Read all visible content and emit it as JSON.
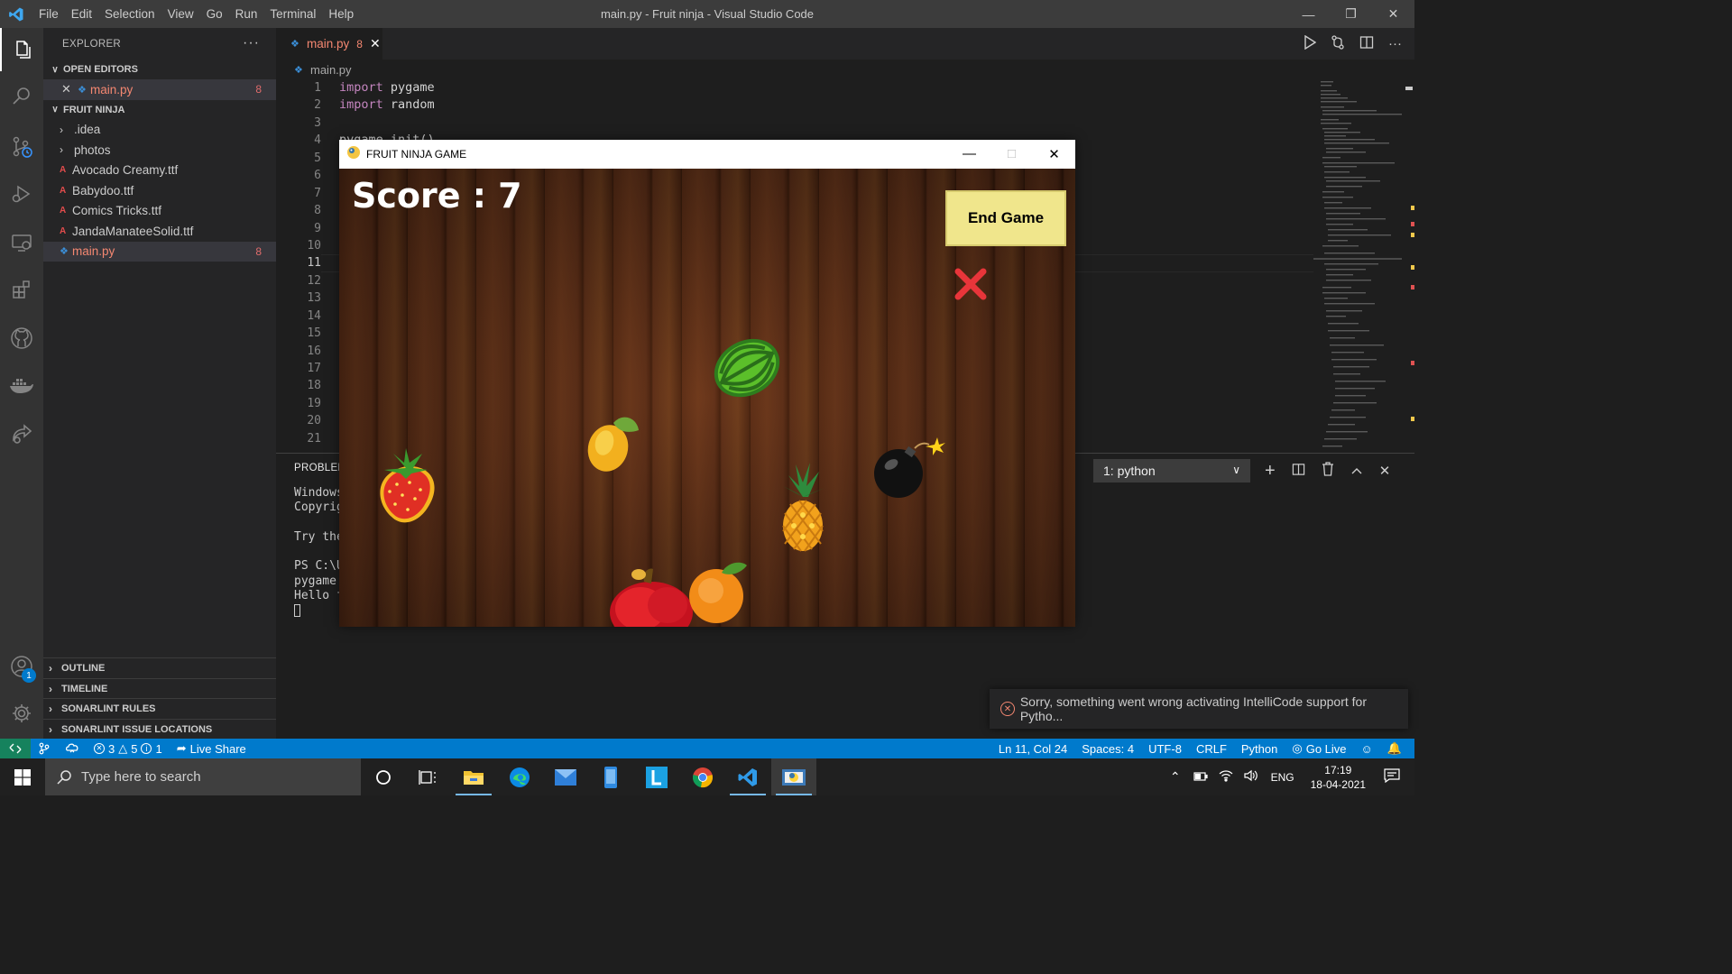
{
  "window": {
    "title": "main.py - Fruit ninja - Visual Studio Code",
    "menu": [
      "File",
      "Edit",
      "Selection",
      "View",
      "Go",
      "Run",
      "Terminal",
      "Help"
    ]
  },
  "activity_bar": {
    "items": [
      "explorer-icon",
      "search-icon",
      "source-control-icon",
      "run-debug-icon",
      "remote-explorer-icon",
      "extensions-icon",
      "github-icon",
      "docker-icon",
      "live-share-icon"
    ],
    "accounts_badge": "1"
  },
  "sidebar": {
    "title": "EXPLORER",
    "open_editors": {
      "header": "OPEN EDITORS",
      "items": [
        {
          "name": "main.py",
          "count": "8"
        }
      ]
    },
    "project": {
      "header": "FRUIT NINJA",
      "items": [
        {
          "name": ".idea",
          "type": "folder"
        },
        {
          "name": "photos",
          "type": "folder"
        },
        {
          "name": "Avocado Creamy.ttf",
          "type": "font"
        },
        {
          "name": "Babydoo.ttf",
          "type": "font"
        },
        {
          "name": "Comics Tricks.ttf",
          "type": "font"
        },
        {
          "name": "JandaManateeSolid.ttf",
          "type": "font"
        },
        {
          "name": "main.py",
          "type": "python",
          "count": "8"
        }
      ]
    },
    "bottom_sections": [
      "OUTLINE",
      "TIMELINE",
      "SONARLINT RULES",
      "SONARLINT ISSUE LOCATIONS"
    ]
  },
  "editor": {
    "tab": {
      "label": "main.py",
      "count": "8"
    },
    "breadcrumb": "main.py",
    "line_numbers": [
      "1",
      "2",
      "3",
      "4",
      "5",
      "6",
      "7",
      "8",
      "9",
      "10",
      "11",
      "12",
      "13",
      "14",
      "15",
      "16",
      "17",
      "18",
      "19",
      "20",
      "21"
    ],
    "current_line": "11",
    "code": [
      {
        "kw": "import",
        "rest": " pygame"
      },
      {
        "kw": "import",
        "rest": " random"
      },
      {
        "kw": "",
        "rest": ""
      },
      {
        "kw": "",
        "rest": "pygame.init()"
      }
    ]
  },
  "panel": {
    "tab": "PROBLEM",
    "terminal_select": "1: python",
    "terminal_lines": [
      "Windows",
      "Copyrig",
      "",
      "Try the",
      "",
      "PS C:\\U",
      "pygame ",
      "Hello f"
    ]
  },
  "notification": {
    "text": "Sorry, something went wrong activating IntelliCode support for Pytho..."
  },
  "statusbar": {
    "errors": "3",
    "warnings": "5",
    "info": "1",
    "live_share": "Live Share",
    "position": "Ln 11, Col 24",
    "spaces": "Spaces: 4",
    "encoding": "UTF-8",
    "eol": "CRLF",
    "language": "Python",
    "go_live": "Go Live"
  },
  "game": {
    "title": "FRUIT NINJA GAME",
    "score_text": "Score : 7",
    "end_button": "End Game",
    "sprites": [
      "watermelon",
      "mango",
      "strawberry",
      "pineapple",
      "bomb",
      "apple",
      "orange",
      "miss-cross"
    ]
  },
  "taskbar": {
    "search_placeholder": "Type here to search",
    "apps": [
      "cortana",
      "task-view",
      "file-explorer",
      "edge",
      "mail",
      "phone",
      "L-app",
      "chrome",
      "vscode",
      "python"
    ],
    "language": "ENG",
    "time": "17:19",
    "date": "18-04-2021"
  },
  "colors": {
    "accent": "#007acc",
    "error": "#f48771",
    "end_button": "#f0e68c"
  }
}
